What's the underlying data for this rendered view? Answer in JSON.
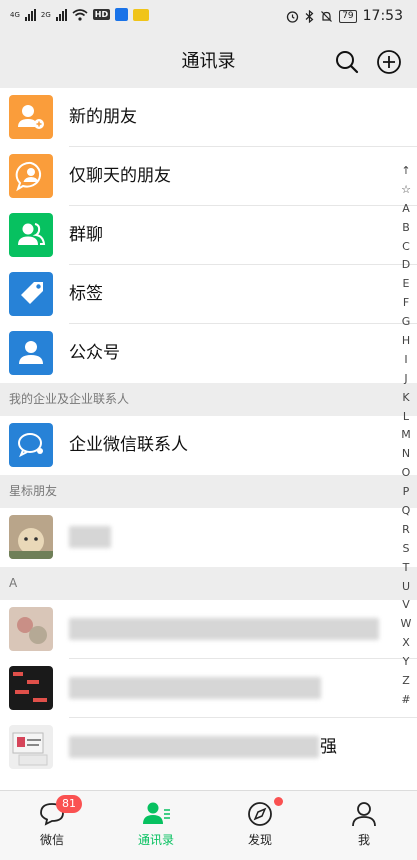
{
  "status_bar": {
    "net1": "4G",
    "net2": "2G",
    "hd": "HD",
    "battery": "79",
    "time": "17:53"
  },
  "header": {
    "title": "通讯录",
    "search_icon": "search-icon",
    "add_icon": "add-circle-icon"
  },
  "functions": [
    {
      "label": "新的朋友",
      "icon": "add-friend-icon",
      "color": "#fa9d3b"
    },
    {
      "label": "仅聊天的朋友",
      "icon": "chat-only-friend-icon",
      "color": "#fa9d3b"
    },
    {
      "label": "群聊",
      "icon": "group-chat-icon",
      "color": "#07c160"
    },
    {
      "label": "标签",
      "icon": "tag-icon",
      "color": "#2782d7"
    },
    {
      "label": "公众号",
      "icon": "official-account-icon",
      "color": "#2782d7"
    }
  ],
  "sections": {
    "enterprise": {
      "header": "我的企业及企业联系人",
      "items": [
        {
          "label": "企业微信联系人",
          "icon": "enterprise-contact-icon",
          "color": "#2782d7"
        }
      ]
    },
    "starred": {
      "header": "星标朋友"
    },
    "a": {
      "header": "A"
    }
  },
  "contacts": [
    {
      "visible_suffix": ""
    },
    {
      "visible_suffix": ""
    },
    {
      "visible_suffix": ""
    },
    {
      "visible_suffix": "强"
    }
  ],
  "index_letters": [
    "↑",
    "☆",
    "A",
    "B",
    "C",
    "D",
    "E",
    "F",
    "G",
    "H",
    "I",
    "J",
    "K",
    "L",
    "M",
    "N",
    "O",
    "P",
    "Q",
    "R",
    "S",
    "T",
    "U",
    "V",
    "W",
    "X",
    "Y",
    "Z",
    "#"
  ],
  "tabs": [
    {
      "label": "微信",
      "icon": "chat-bubble-icon",
      "badge": "81",
      "active": false
    },
    {
      "label": "通讯录",
      "icon": "contacts-icon",
      "active": true
    },
    {
      "label": "发现",
      "icon": "compass-icon",
      "active": false
    },
    {
      "label": "我",
      "icon": "person-icon",
      "active": false
    }
  ],
  "colors": {
    "accent": "#07c160",
    "badge": "#fa5151",
    "orange": "#fa9d3b",
    "blue": "#2782d7"
  }
}
